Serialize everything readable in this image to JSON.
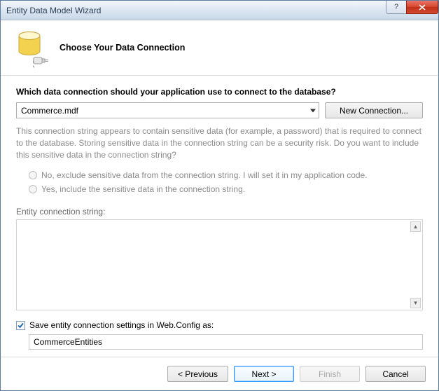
{
  "window": {
    "title": "Entity Data Model Wizard"
  },
  "header": {
    "title": "Choose Your Data Connection"
  },
  "content": {
    "question": "Which data connection should your application use to connect to the database?",
    "dropdown_value": "Commerce.mdf",
    "new_connection_label": "New Connection...",
    "sensitive_warning": "This connection string appears to contain sensitive data (for example, a password) that is required to connect to the database. Storing sensitive data in the connection string can be a security risk. Do you want to include this sensitive data in the connection string?",
    "radio_no": "No, exclude sensitive data from the connection string. I will set it in my application code.",
    "radio_yes": "Yes, include the sensitive data in the connection string.",
    "ecs_label": "Entity connection string:",
    "ecs_value": "",
    "save_label": "Save entity connection settings in Web.Config as:",
    "save_value": "CommerceEntities"
  },
  "footer": {
    "previous": "< Previous",
    "next": "Next >",
    "finish": "Finish",
    "cancel": "Cancel"
  }
}
